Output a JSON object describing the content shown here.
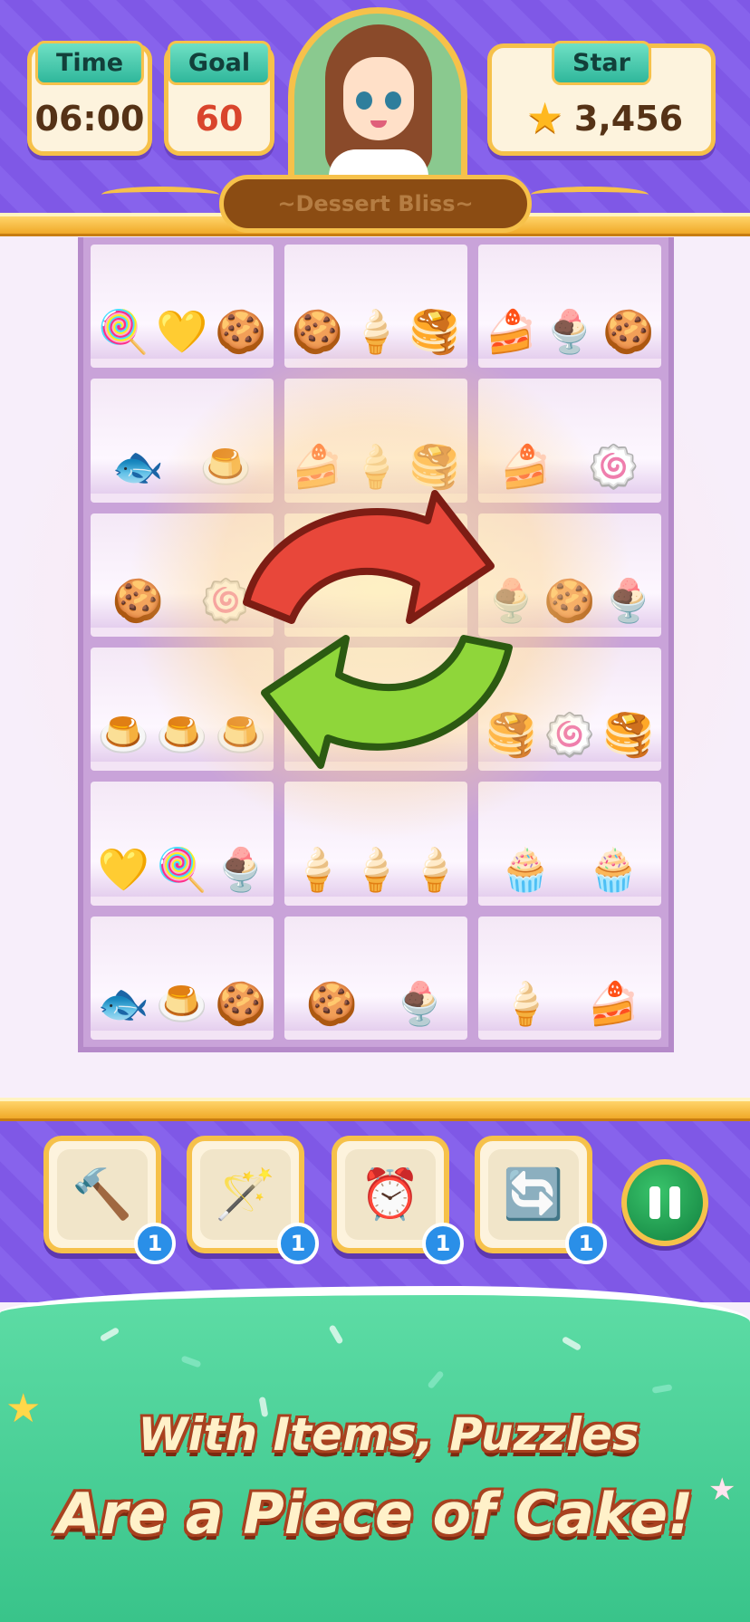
{
  "hud": {
    "time_label": "Time",
    "time_value": "06:00",
    "goal_label": "Goal",
    "goal_value": "60",
    "star_label": "Star",
    "star_value": "3,456",
    "star_icon": "star-icon"
  },
  "level": {
    "name": "~Dessert Bliss~"
  },
  "colors": {
    "purple": "#7f58e6",
    "gold": "#f6c14a",
    "teal_tag": "#2fb79b",
    "green_footer": "#39c48a",
    "badge_blue": "#2a8fe8"
  },
  "board": {
    "rows": [
      [
        [
          "🍭",
          "💛",
          "🍪"
        ],
        [
          "🍪",
          "🍦",
          "🥞"
        ],
        [
          "🍰",
          "🍨",
          "🍪"
        ]
      ],
      [
        [
          "🐟",
          "🍮"
        ],
        [
          "🍰",
          "🍦",
          "🥞"
        ],
        [
          "🍰",
          "🍥"
        ]
      ],
      [
        [
          "🍪",
          "🍥"
        ],
        [
          "",
          ""
        ],
        [
          "🍨",
          "🍪",
          "🍨"
        ]
      ],
      [
        [
          "🍮",
          "🍮",
          "🍮"
        ],
        [
          "",
          ""
        ],
        [
          "🥞",
          "🍥",
          "🥞"
        ]
      ],
      [
        [
          "💛",
          "🍭",
          "🍨"
        ],
        [
          "🍦",
          "🍦",
          "🍦"
        ],
        [
          "🧁",
          "🧁"
        ]
      ],
      [
        [
          "🐟",
          "🍮",
          "🍪"
        ],
        [
          "🍪",
          "🍨"
        ],
        [
          "🍦",
          "🍰"
        ]
      ]
    ],
    "overlay_icon": "shuffle-icon"
  },
  "tools": [
    {
      "icon": "hammer-icon",
      "glyph": "🔨",
      "count": "1"
    },
    {
      "icon": "magic-wand-icon",
      "glyph": "🪄",
      "count": "1"
    },
    {
      "icon": "clock-box-icon",
      "glyph": "⏰",
      "count": "1"
    },
    {
      "icon": "shuffle-icon",
      "glyph": "🔄",
      "count": "1"
    }
  ],
  "promo": {
    "line1": "With Items, Puzzles",
    "line2": "Are a Piece of Cake!"
  }
}
